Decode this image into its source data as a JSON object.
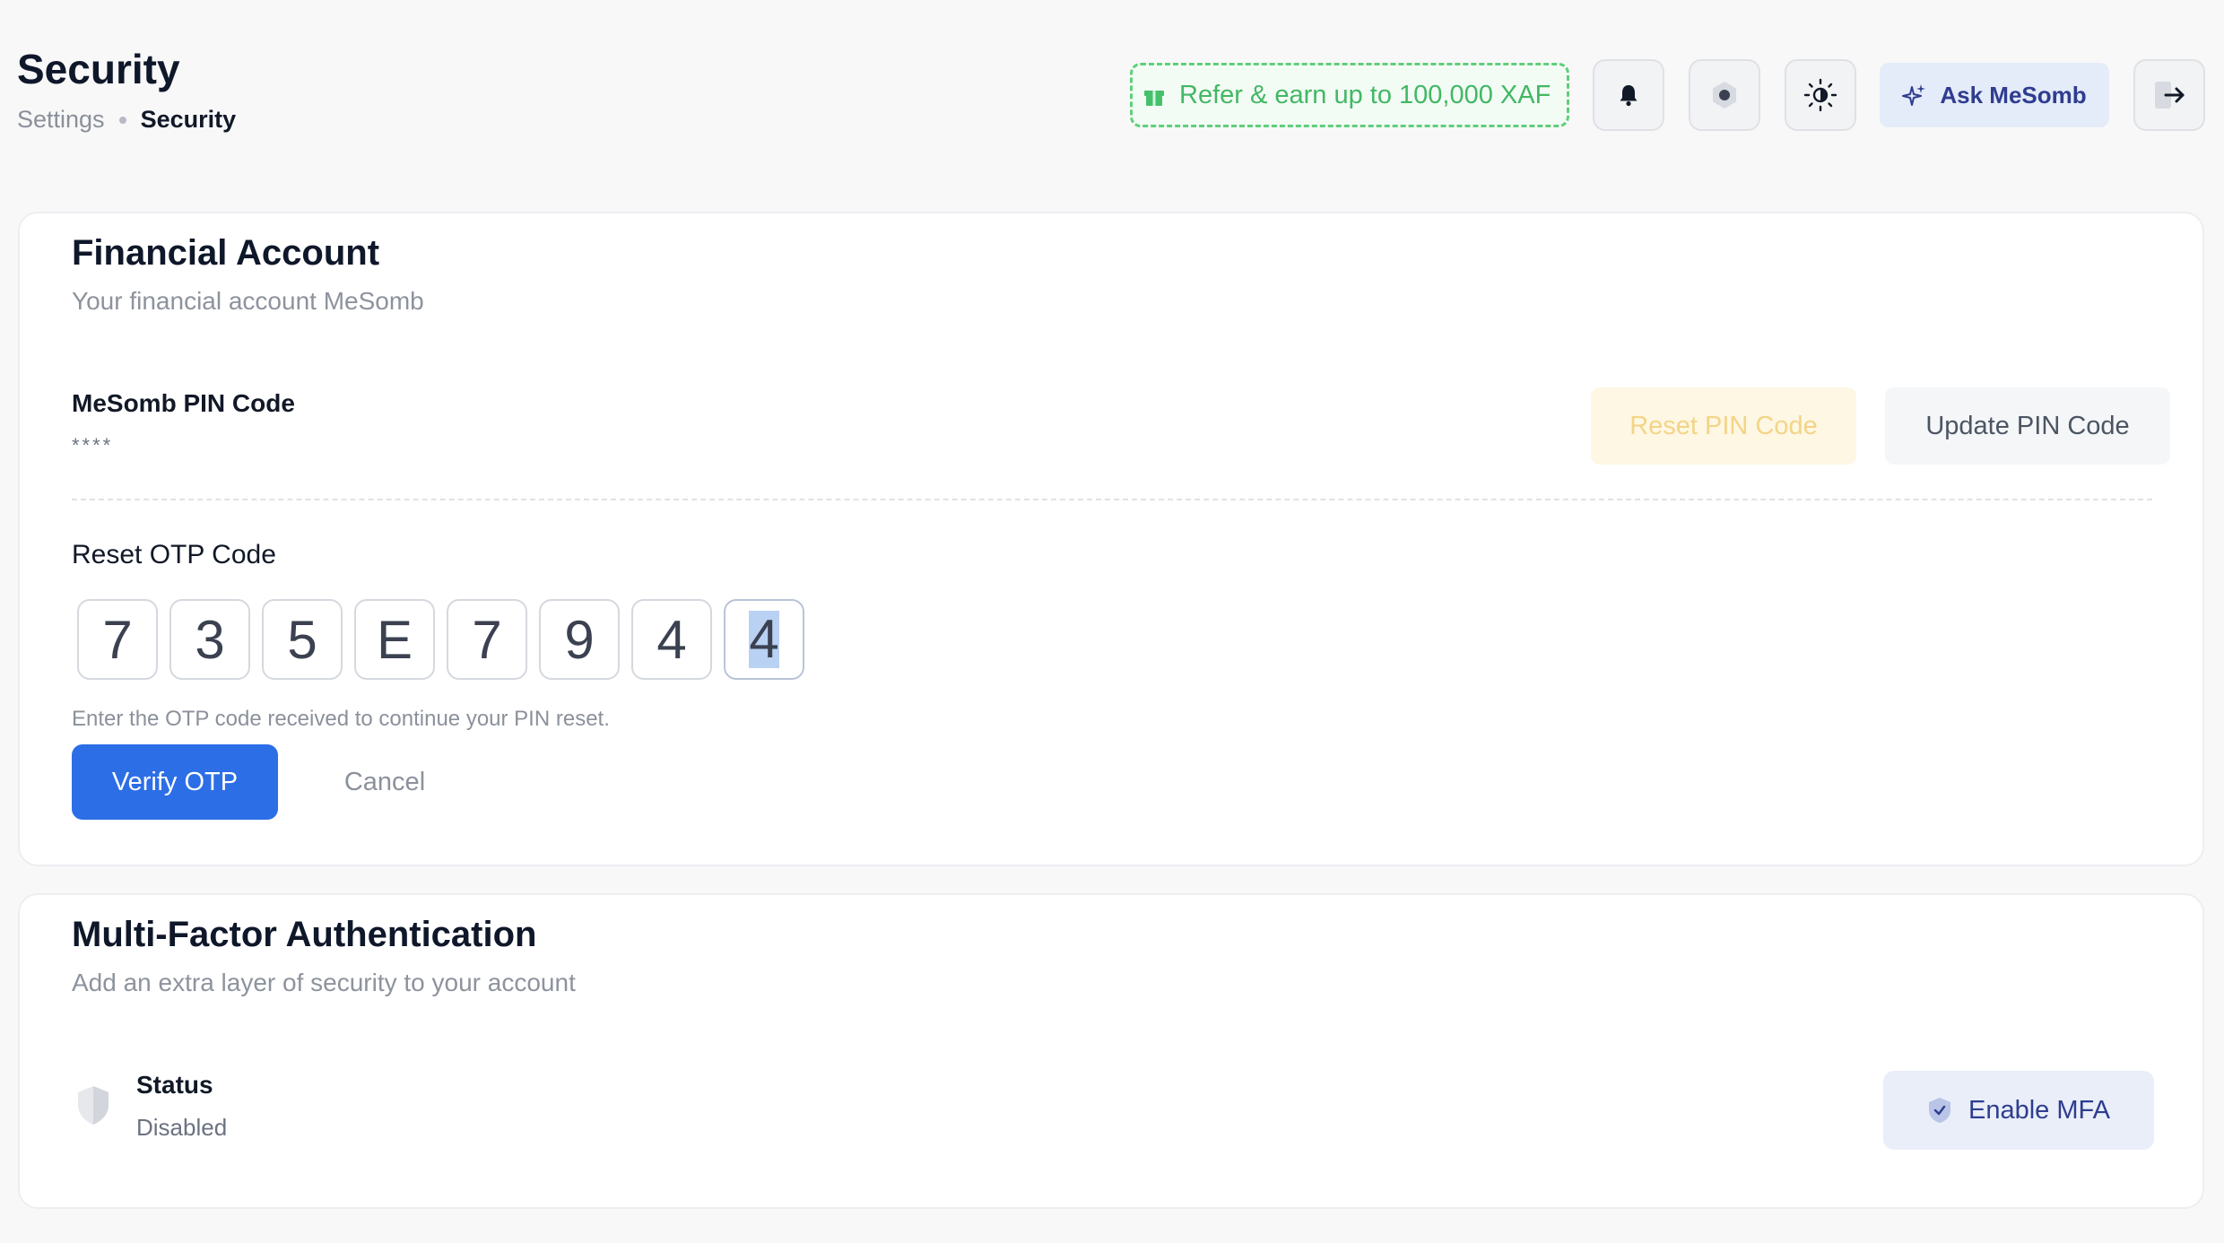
{
  "header": {
    "title": "Security",
    "breadcrumb": {
      "parent": "Settings",
      "current": "Security"
    },
    "refer_label": "Refer & earn up to 100,000 XAF",
    "ask_label": "Ask MeSomb",
    "icons": [
      "bell-icon",
      "hexagon-icon",
      "sun-icon",
      "sparkle-icon",
      "logout-icon"
    ]
  },
  "financial": {
    "title": "Financial Account",
    "subtitle": "Your financial account MeSomb",
    "pin_label": "MeSomb PIN Code",
    "pin_mask": "****",
    "reset_pin_label": "Reset PIN Code",
    "update_pin_label": "Update PIN Code",
    "otp_label": "Reset OTP Code",
    "otp_digits": [
      "7",
      "3",
      "5",
      "E",
      "7",
      "9",
      "4",
      "4"
    ],
    "otp_help": "Enter the OTP code received to continue your PIN reset.",
    "verify_label": "Verify OTP",
    "cancel_label": "Cancel"
  },
  "mfa": {
    "title": "Multi-Factor Authentication",
    "subtitle": "Add an extra layer of security to your account",
    "status_label": "Status",
    "status_value": "Disabled",
    "enable_label": "Enable MFA"
  },
  "colors": {
    "primary": "#2c6ee6",
    "refer_green": "#42b864",
    "ask_bg": "#e4ebf9",
    "reset_pin_bg": "#fef7e3"
  }
}
